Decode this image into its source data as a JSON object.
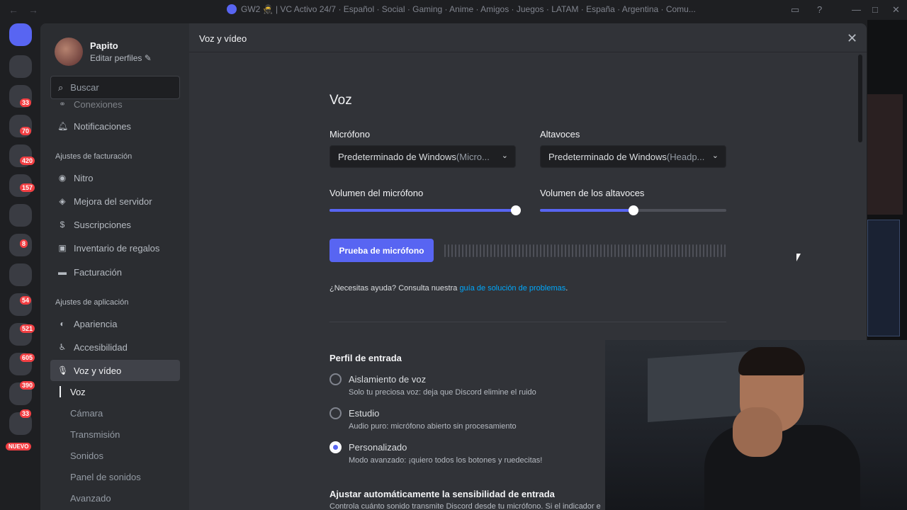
{
  "titlebar": {
    "title": "GW2 🥷 | VC Activo 24/7 · Español · Social · Gaming · Anime · Amigos · Juegos · LATAM · España · Argentina · Comu..."
  },
  "server_rail": {
    "badges": [
      "33",
      "70",
      "420",
      "157",
      "8",
      "54",
      "521",
      "605",
      "390",
      "33"
    ],
    "new_label": "NUEVO"
  },
  "settings": {
    "header_title": "Voz y vídeo",
    "profile": {
      "name": "Papito",
      "edit_label": "Editar perfiles"
    },
    "search_placeholder": "Buscar",
    "nav": {
      "item_connections": "Conexiones",
      "item_notifications": "Notificaciones",
      "billing_header": "Ajustes de facturación",
      "item_nitro": "Nitro",
      "item_boost": "Mejora del servidor",
      "item_subscriptions": "Suscripciones",
      "item_gifts": "Inventario de regalos",
      "item_billing": "Facturación",
      "app_header": "Ajustes de aplicación",
      "item_appearance": "Apariencia",
      "item_accessibility": "Accesibilidad",
      "item_voice": "Voz y vídeo",
      "sub_voice": "Voz",
      "sub_camera": "Cámara",
      "sub_stream": "Transmisión",
      "sub_sounds": "Sonidos",
      "sub_soundboard": "Panel de sonidos",
      "sub_advanced": "Avanzado"
    }
  },
  "voice": {
    "title": "Voz",
    "mic_label": "Micrófono",
    "mic_device": "Predeterminado de Windows",
    "mic_device_detail": " (Micro...",
    "speaker_label": "Altavoces",
    "speaker_device": "Predeterminado de Windows",
    "speaker_device_detail": " (Headp...",
    "mic_volume_label": "Volumen del micrófono",
    "mic_volume": 1.0,
    "speaker_volume_label": "Volumen de los altavoces",
    "speaker_volume": 0.5,
    "mic_test_button": "Prueba de micrófono",
    "help_text": "¿Necesitas ayuda? Consulta nuestra ",
    "help_link": "guía de solución de problemas",
    "help_end": "."
  },
  "input_profile": {
    "title": "Perfil de entrada",
    "options": [
      {
        "label": "Aislamiento de voz",
        "desc": "Solo tu preciosa voz: deja que Discord elimine el ruido",
        "selected": false
      },
      {
        "label": "Estudio",
        "desc": "Audio puro: micrófono abierto sin procesamiento",
        "selected": false
      },
      {
        "label": "Personalizado",
        "desc": "Modo avanzado: ¡quiero todos los botones y ruedecitas!",
        "selected": true
      }
    ],
    "auto_sensitivity_title": "Ajustar automáticamente la sensibilidad de entrada",
    "auto_sensitivity_desc": "Controla cuánto sonido transmite Discord desde tu micrófono. Si el indicador e"
  },
  "colors": {
    "accent": "#5865f2",
    "link": "#00a8fc",
    "bg": "#313338",
    "sidebar": "#2b2d31"
  }
}
